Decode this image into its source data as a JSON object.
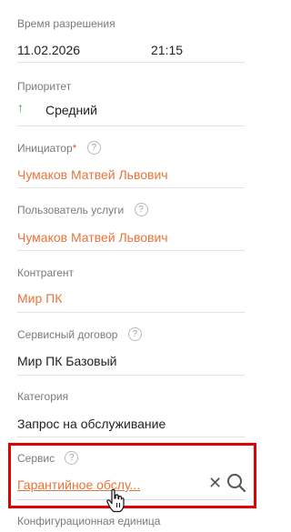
{
  "fields": {
    "resolution_time": {
      "label": "Время разрешения",
      "date": "11.02.2026",
      "time": "21:15"
    },
    "priority": {
      "label": "Приоритет",
      "value": "Средний",
      "icon": "arrow-up-icon"
    },
    "initiator": {
      "label": "Инициатор",
      "required_mark": "*",
      "value": "Чумаков Матвей Львович"
    },
    "service_user": {
      "label": "Пользователь услуги",
      "value": "Чумаков Матвей Львович"
    },
    "counterparty": {
      "label": "Контрагент",
      "value": "Мир ПК"
    },
    "service_contract": {
      "label": "Сервисный договор",
      "value": "Мир ПК Базовый"
    },
    "category": {
      "label": "Категория",
      "value": "Запрос на обслуживание"
    },
    "service": {
      "label": "Сервис",
      "value": "Гарантийное обслу..."
    },
    "configuration_unit": {
      "label": "Конфигурационная единица"
    }
  },
  "help_glyph": "?",
  "colors": {
    "link": "#e8743b",
    "highlight": "#e10000",
    "priority_arrow": "#3aa745"
  }
}
